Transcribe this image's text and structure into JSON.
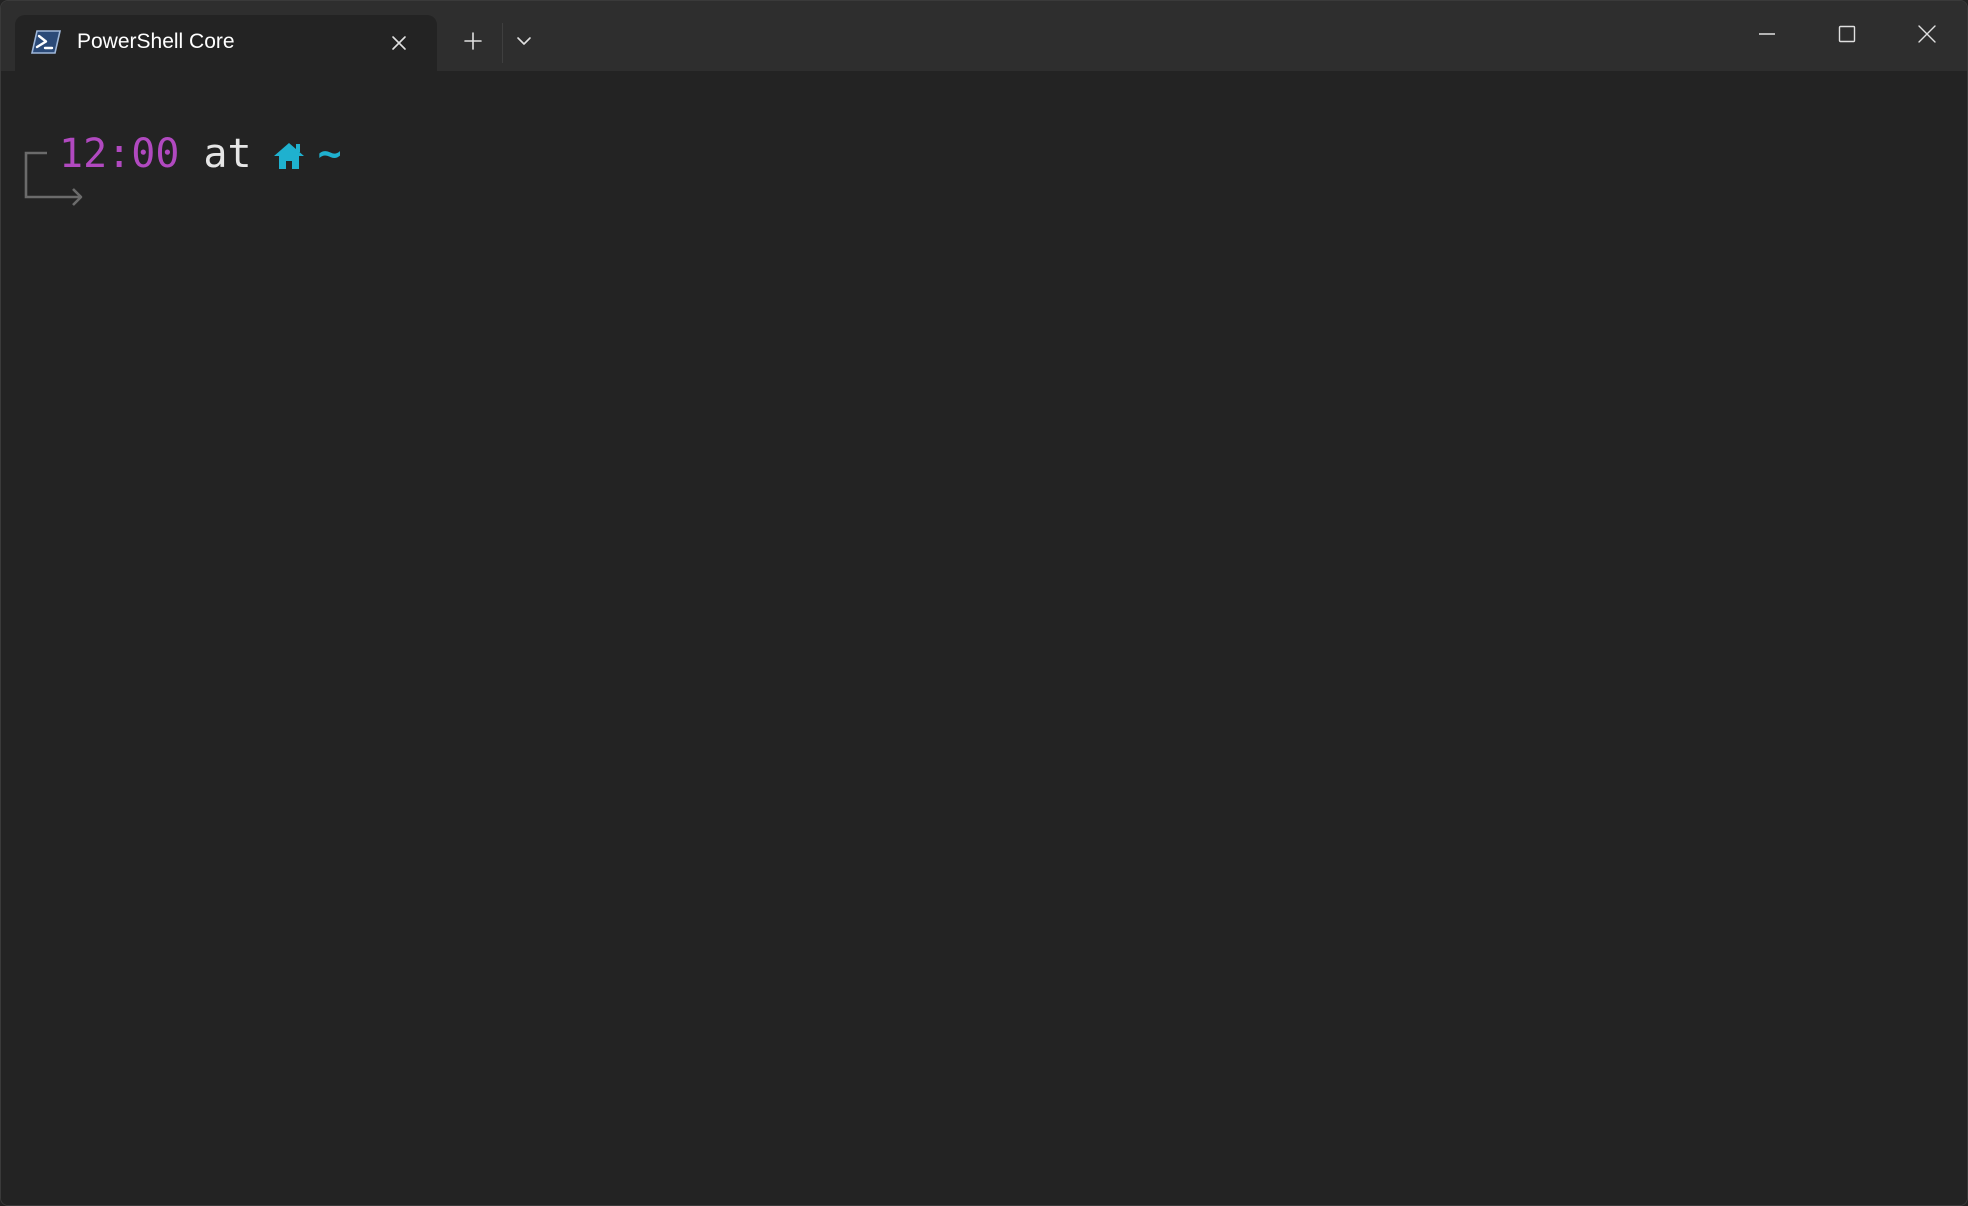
{
  "window": {
    "tab_title": "PowerShell Core",
    "tab_icon": "powershell-icon",
    "new_tab_icon": "plus-icon",
    "dropdown_icon": "chevron-down-icon",
    "minimize_icon": "minimize-icon",
    "maximize_icon": "maximize-icon",
    "close_icon": "close-icon"
  },
  "terminal": {
    "time": "12:00",
    "connector": "at",
    "home_icon": "home-icon",
    "path": "~"
  },
  "colors": {
    "background": "#232323",
    "titlebar": "#2e2e2e",
    "time": "#b149c0",
    "path": "#1fb1cf",
    "text": "#e6e6e6"
  }
}
